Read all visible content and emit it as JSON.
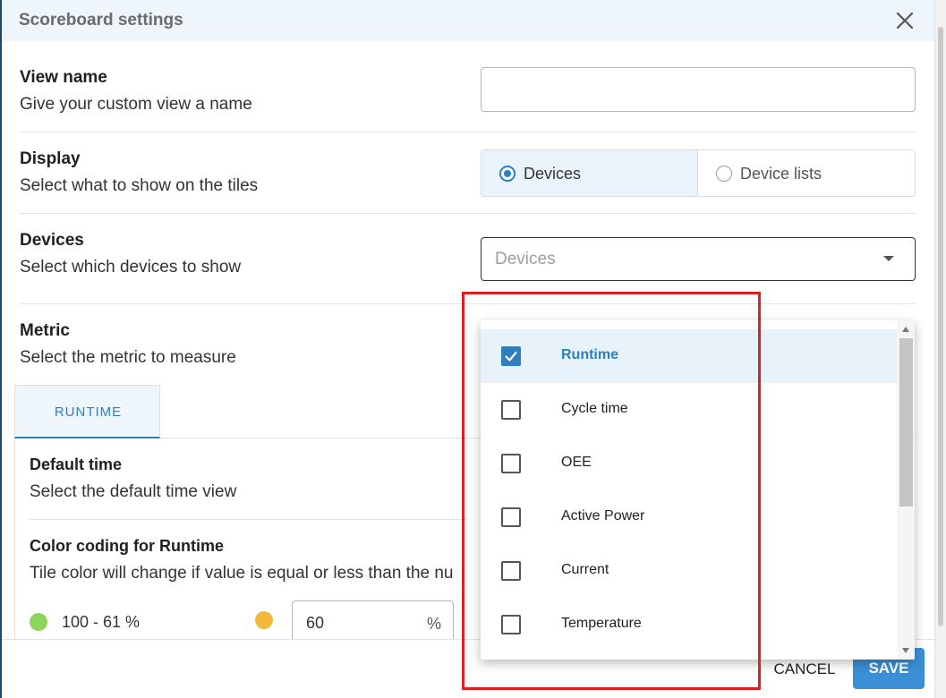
{
  "dialog": {
    "title": "Scoreboard settings"
  },
  "view_name": {
    "title": "View name",
    "subtitle": "Give your custom view a name",
    "value": ""
  },
  "display": {
    "title": "Display",
    "subtitle": "Select what to show on the tiles",
    "options": [
      "Devices",
      "Device lists"
    ],
    "selected": "Devices"
  },
  "devices": {
    "title": "Devices",
    "subtitle": "Select which devices to show",
    "placeholder": "Devices"
  },
  "metric": {
    "title": "Metric",
    "subtitle": "Select the metric to measure",
    "tabs": [
      "RUNTIME"
    ]
  },
  "default_time": {
    "title": "Default time",
    "subtitle": "Select the default time view"
  },
  "color_coding": {
    "title": "Color coding for Runtime",
    "subtitle": "Tile color will change if value is equal or less than the nu",
    "green_range": "100 - 61 %",
    "threshold_value": "60",
    "threshold_unit": "%",
    "colors": {
      "green": "#8bd65a",
      "amber": "#f3b83c"
    }
  },
  "metric_menu": {
    "items": [
      {
        "label": "Runtime",
        "checked": true
      },
      {
        "label": "Cycle time",
        "checked": false
      },
      {
        "label": "OEE",
        "checked": false
      },
      {
        "label": "Active Power",
        "checked": false
      },
      {
        "label": "Current",
        "checked": false
      },
      {
        "label": "Temperature",
        "checked": false
      }
    ]
  },
  "footer": {
    "cancel_label": "CANCEL",
    "save_label": "SAVE"
  },
  "theme": {
    "accent": "#2c7fc0",
    "highlight_box": "#e02020"
  }
}
